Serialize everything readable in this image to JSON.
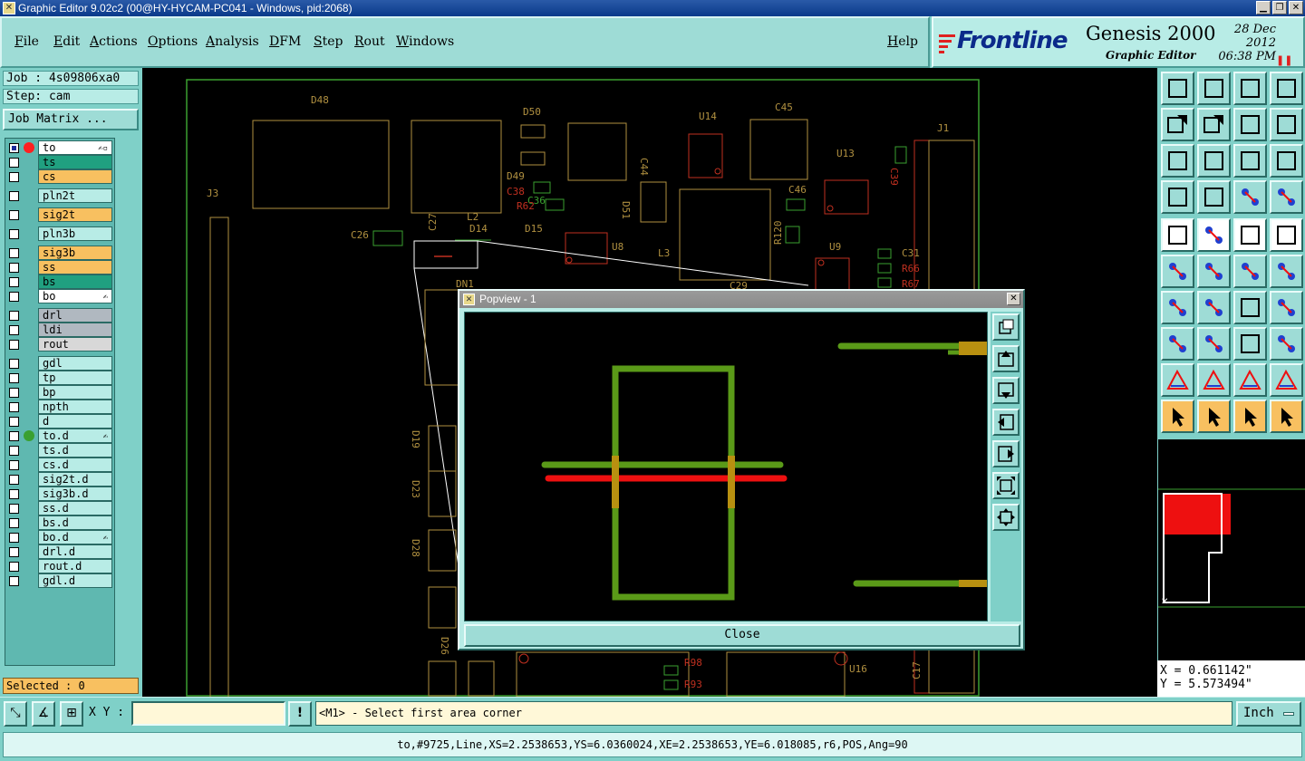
{
  "window": {
    "title": "Graphic Editor 9.02c2 (00@HY-HYCAM-PC041 - Windows, pid:2068)"
  },
  "menu": {
    "items": [
      "File",
      "Edit",
      "Actions",
      "Options",
      "Analysis",
      "DFM",
      "Step",
      "Rout",
      "Windows"
    ],
    "help": "Help"
  },
  "brand": {
    "logo": "Frontline",
    "product": "Genesis 2000",
    "subtitle": "Graphic Editor",
    "date": "28 Dec 2012",
    "time": "06:38 PM"
  },
  "job": {
    "job_label": "Job : 4s09806xa0",
    "step_label": "Step: cam",
    "matrix_button": "Job Matrix ..."
  },
  "layers": [
    {
      "name": "to",
      "color": "#ffffff",
      "checked": true,
      "dot": "#ff2020",
      "mark": "✍▫"
    },
    {
      "name": "ts",
      "color": "#20a080",
      "checked": false,
      "dot": "",
      "mark": ""
    },
    {
      "name": "cs",
      "color": "#f8c060",
      "checked": false,
      "dot": "",
      "mark": ""
    },
    {
      "name": "pln2t",
      "color": "#b8ece6",
      "checked": false,
      "dot": "",
      "mark": ""
    },
    {
      "name": "sig2t",
      "color": "#f8c060",
      "checked": false,
      "dot": "",
      "mark": ""
    },
    {
      "name": "pln3b",
      "color": "#b8ece6",
      "checked": false,
      "dot": "",
      "mark": ""
    },
    {
      "name": "sig3b",
      "color": "#f8c060",
      "checked": false,
      "dot": "",
      "mark": ""
    },
    {
      "name": "ss",
      "color": "#f8c060",
      "checked": false,
      "dot": "",
      "mark": ""
    },
    {
      "name": "bs",
      "color": "#20a080",
      "checked": false,
      "dot": "",
      "mark": ""
    },
    {
      "name": "bo",
      "color": "#ffffff",
      "checked": false,
      "dot": "",
      "mark": "✍"
    },
    {
      "name": "drl",
      "color": "#b0b8c0",
      "checked": false,
      "dot": "",
      "mark": ""
    },
    {
      "name": "ldi",
      "color": "#b0b8c0",
      "checked": false,
      "dot": "",
      "mark": ""
    },
    {
      "name": "rout",
      "color": "#d8d8d8",
      "checked": false,
      "dot": "",
      "mark": ""
    },
    {
      "name": "gdl",
      "color": "#b8ece6",
      "checked": false,
      "dot": "",
      "mark": ""
    },
    {
      "name": "tp",
      "color": "#b8ece6",
      "checked": false,
      "dot": "",
      "mark": ""
    },
    {
      "name": "bp",
      "color": "#b8ece6",
      "checked": false,
      "dot": "",
      "mark": ""
    },
    {
      "name": "npth",
      "color": "#b8ece6",
      "checked": false,
      "dot": "",
      "mark": ""
    },
    {
      "name": "d",
      "color": "#b8ece6",
      "checked": false,
      "dot": "",
      "mark": ""
    },
    {
      "name": "to.d",
      "color": "#b8ece6",
      "checked": false,
      "dot": "#3aa030",
      "mark": "✍"
    },
    {
      "name": "ts.d",
      "color": "#b8ece6",
      "checked": false,
      "dot": "",
      "mark": ""
    },
    {
      "name": "cs.d",
      "color": "#b8ece6",
      "checked": false,
      "dot": "",
      "mark": ""
    },
    {
      "name": "sig2t.d",
      "color": "#b8ece6",
      "checked": false,
      "dot": "",
      "mark": ""
    },
    {
      "name": "sig3b.d",
      "color": "#b8ece6",
      "checked": false,
      "dot": "",
      "mark": ""
    },
    {
      "name": "ss.d",
      "color": "#b8ece6",
      "checked": false,
      "dot": "",
      "mark": ""
    },
    {
      "name": "bs.d",
      "color": "#b8ece6",
      "checked": false,
      "dot": "",
      "mark": ""
    },
    {
      "name": "bo.d",
      "color": "#b8ece6",
      "checked": false,
      "dot": "",
      "mark": "✍"
    },
    {
      "name": "drl.d",
      "color": "#b8ece6",
      "checked": false,
      "dot": "",
      "mark": ""
    },
    {
      "name": "rout.d",
      "color": "#b8ece6",
      "checked": false,
      "dot": "",
      "mark": ""
    },
    {
      "name": "gdl.d",
      "color": "#b8ece6",
      "checked": false,
      "dot": "",
      "mark": ""
    }
  ],
  "selected": "Selected : 0",
  "components": [
    "D48",
    "D50",
    "U14",
    "C45",
    "J1",
    "C44",
    "U13",
    "C38",
    "C36",
    "D49",
    "R62",
    "D51",
    "C46",
    "J3",
    "C26",
    "C27",
    "L2",
    "D14",
    "D15",
    "U8",
    "L3",
    "R120",
    "U9",
    "C31",
    "R66",
    "R67",
    "C29",
    "DN1",
    "D19",
    "D23",
    "D28",
    "D26",
    "R98",
    "R93",
    "U16",
    "C17",
    "C39"
  ],
  "popview": {
    "title": "Popview - 1",
    "close_label": "Close"
  },
  "coords": {
    "x": "X = 0.661142\"",
    "y": "Y = 5.573494\""
  },
  "command": {
    "xy_label": "X Y :",
    "xy_value": "",
    "prompt": "<M1> - Select first area corner",
    "units": "Inch"
  },
  "status": "to,#9725,Line,XS=2.2538653,YS=6.0360024,XE=2.2538653,YE=6.018085,r6,POS,Ang=90",
  "icons": {
    "toolbox": [
      "home-icon",
      "zoom-home-icon",
      "layout-icon",
      "window-split-icon",
      "pan-left-icon",
      "pan-right-icon",
      "undo-icon",
      "redo-icon",
      "fit-icon",
      "zoom-icon",
      "ratio-icon",
      "help-icon",
      "measure-tools-icon",
      "grid-icon",
      "snap-icon",
      "snap-on-icon",
      "feature-select-icon",
      "highlight-icon",
      "ruler-icon",
      "pad-icon",
      "netlist-icon",
      "cross-icon",
      "connect-icon",
      "connect-alt-icon",
      "route-icon",
      "line-icon",
      "arc-icon",
      "split-icon",
      "pad-add-icon",
      "line-cut-icon",
      "measure-icon",
      "shapes-icon",
      "triangle-icon",
      "triangle-alt-icon",
      "triangle-frame-icon",
      "triangle-cut-icon",
      "pointer-icon",
      "pointer-box-icon",
      "pointer-frame-icon",
      "pointer-net-icon"
    ]
  }
}
